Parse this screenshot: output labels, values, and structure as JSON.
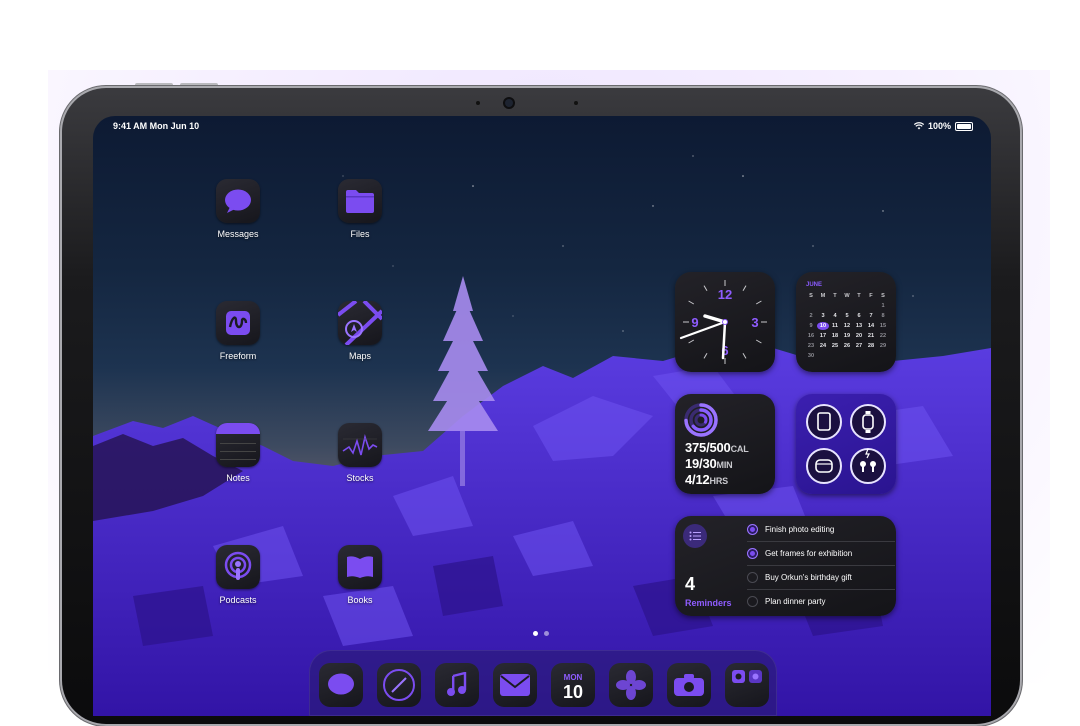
{
  "colors": {
    "accent": "#7b4cf0",
    "accent_light": "#9a74ff",
    "widget_bg": "#1b1b20"
  },
  "status_bar": {
    "time": "9:41 AM  Mon Jun 10",
    "battery": "100%",
    "wifi_icon": "wifi-icon",
    "battery_icon": "battery-icon"
  },
  "apps": [
    {
      "label": "Messages",
      "icon": "messages-icon"
    },
    {
      "label": "Files",
      "icon": "folder-icon"
    },
    {
      "label": "Freeform",
      "icon": "freeform-icon"
    },
    {
      "label": "Maps",
      "icon": "maps-icon"
    },
    {
      "label": "Notes",
      "icon": "notes-icon"
    },
    {
      "label": "Stocks",
      "icon": "stocks-icon"
    },
    {
      "label": "Podcasts",
      "icon": "podcasts-icon"
    },
    {
      "label": "Books",
      "icon": "books-icon"
    }
  ],
  "clock_widget": {
    "numerals": [
      "12",
      "3",
      "6",
      "9"
    ]
  },
  "calendar_widget": {
    "month": "JUNE",
    "weekdays": [
      "S",
      "M",
      "T",
      "W",
      "T",
      "F",
      "S"
    ],
    "weeks": [
      [
        "",
        "",
        "",
        "",
        "",
        "",
        "1"
      ],
      [
        "2",
        "3",
        "4",
        "5",
        "6",
        "7",
        "8"
      ],
      [
        "9",
        "10",
        "11",
        "12",
        "13",
        "14",
        "15"
      ],
      [
        "16",
        "17",
        "18",
        "19",
        "20",
        "21",
        "22"
      ],
      [
        "23",
        "24",
        "25",
        "26",
        "27",
        "28",
        "29"
      ],
      [
        "30",
        "",
        "",
        "",
        "",
        "",
        ""
      ]
    ],
    "today": "10"
  },
  "fitness_widget": {
    "move": "375/500",
    "move_unit": "CAL",
    "exercise": "19/30",
    "exercise_unit": "MIN",
    "stand": "4/12",
    "stand_unit": "HRS"
  },
  "batteries_widget": {
    "devices": [
      "ipad-icon",
      "watch-icon",
      "case-icon",
      "airpods-icon"
    ]
  },
  "reminders_widget": {
    "count": "4",
    "label": "Reminders",
    "items": [
      {
        "text": "Finish photo editing",
        "done": true
      },
      {
        "text": "Get frames for exhibition",
        "done": true
      },
      {
        "text": "Buy Orkun's birthday gift",
        "done": false
      },
      {
        "text": "Plan dinner party",
        "done": false
      }
    ]
  },
  "dock": {
    "calendar_day": "MON",
    "icons": [
      "messages-icon",
      "safari-icon",
      "music-icon",
      "mail-icon",
      "calendar-icon",
      "photos-icon",
      "camera-icon",
      "utilities-icon"
    ]
  }
}
